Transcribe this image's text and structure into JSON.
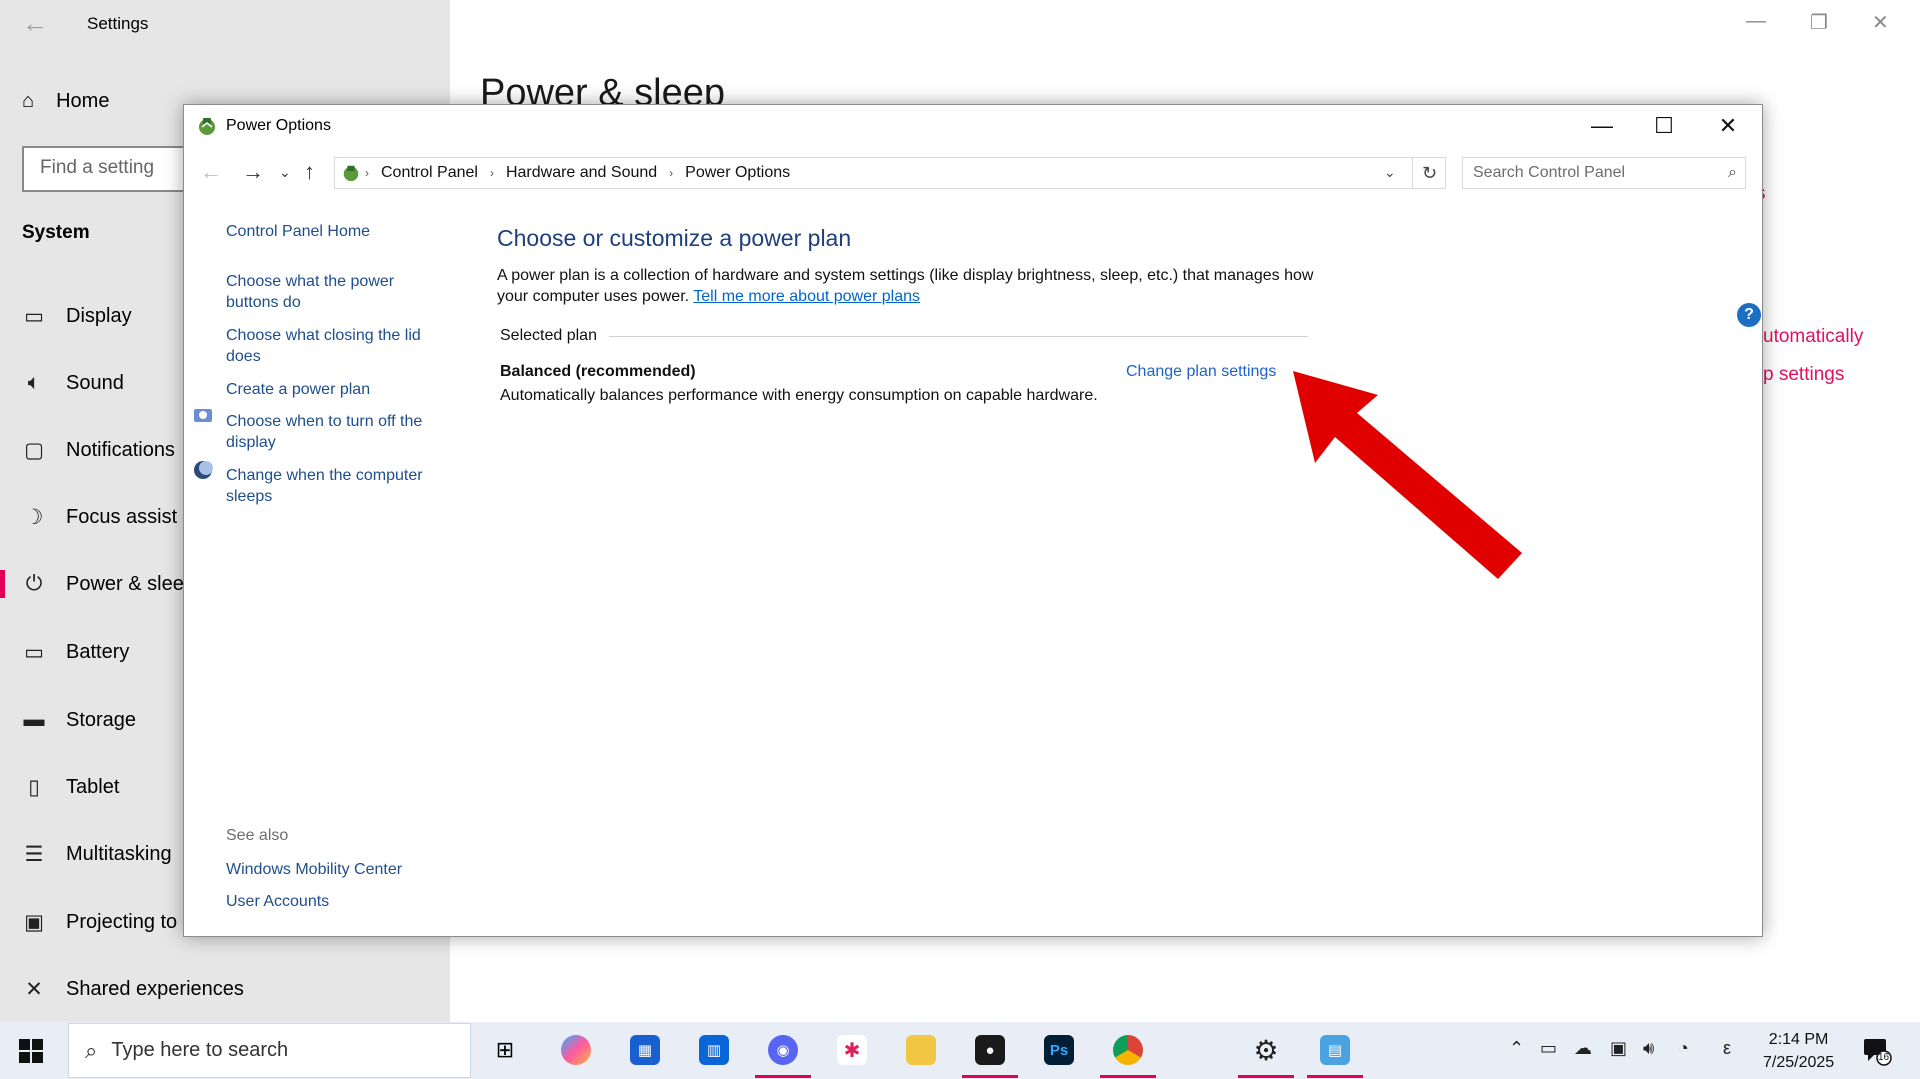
{
  "settings": {
    "title": "Settings",
    "home_label": "Home",
    "search_placeholder": "Find a setting",
    "section_label": "System",
    "page_heading": "Power & sleep",
    "nav_items": [
      {
        "label": "Display",
        "icon": "monitor-icon"
      },
      {
        "label": "Sound",
        "icon": "speaker-icon"
      },
      {
        "label": "Notifications",
        "icon": "notification-icon"
      },
      {
        "label": "Focus assist",
        "icon": "moon-icon"
      },
      {
        "label": "Power & sleep",
        "icon": "power-icon"
      },
      {
        "label": "Battery",
        "icon": "battery-icon"
      },
      {
        "label": "Storage",
        "icon": "storage-icon"
      },
      {
        "label": "Tablet",
        "icon": "tablet-icon"
      },
      {
        "label": "Multitasking",
        "icon": "multitasking-icon"
      },
      {
        "label": "Projecting to",
        "icon": "projector-icon"
      },
      {
        "label": "Shared experiences",
        "icon": "share-icon"
      }
    ],
    "right_links": {
      "partial_1": "s",
      "partial_2": "utomatically",
      "partial_3": "p settings"
    },
    "accent_color": "#e3005b"
  },
  "power_window": {
    "title": "Power Options",
    "breadcrumb": [
      "Control Panel",
      "Hardware and Sound",
      "Power Options"
    ],
    "search_placeholder": "Search Control Panel",
    "left_links": {
      "home": "Control Panel Home",
      "buttons": "Choose what the power buttons do",
      "lid": "Choose what closing the lid does",
      "create": "Create a power plan",
      "display_off": "Choose when to turn off the display",
      "sleep": "Change when the computer sleeps"
    },
    "see_also": {
      "label": "See also",
      "mobility": "Windows Mobility Center",
      "accounts": "User Accounts"
    },
    "heading": "Choose or customize a power plan",
    "description": "A power plan is a collection of hardware and system settings (like display brightness, sleep, etc.) that manages how your computer uses power.",
    "learn_more": "Tell me more about power plans",
    "selected_plan_label": "Selected plan",
    "plan_name": "Balanced (recommended)",
    "change_plan": "Change plan settings",
    "plan_description": "Automatically balances performance with energy consumption on capable hardware.",
    "help_label": "?"
  },
  "taskbar": {
    "search_placeholder": "Type here to search",
    "time": "2:14 PM",
    "date": "7/25/2025",
    "notification_count": "16",
    "input_indicator": "ε"
  },
  "annotation": {
    "color": "#e00000"
  }
}
